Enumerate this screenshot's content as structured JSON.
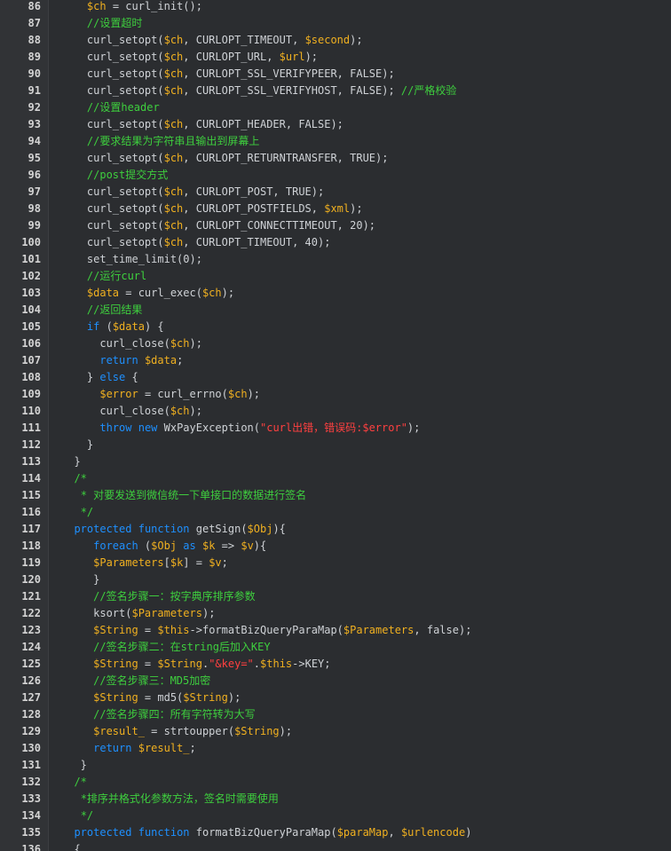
{
  "editor": {
    "lines": [
      {
        "n": "86",
        "t": [
          [
            "pl",
            "    "
          ],
          [
            "var",
            "$ch"
          ],
          [
            "pl",
            " = curl_init();"
          ]
        ]
      },
      {
        "n": "87",
        "t": [
          [
            "pl",
            "    "
          ],
          [
            "cm",
            "//设置超时"
          ]
        ]
      },
      {
        "n": "88",
        "t": [
          [
            "pl",
            "    curl_setopt("
          ],
          [
            "var",
            "$ch"
          ],
          [
            "pl",
            ", CURLOPT_TIMEOUT, "
          ],
          [
            "var",
            "$second"
          ],
          [
            "pl",
            ");"
          ]
        ]
      },
      {
        "n": "89",
        "t": [
          [
            "pl",
            "    curl_setopt("
          ],
          [
            "var",
            "$ch"
          ],
          [
            "pl",
            ", CURLOPT_URL, "
          ],
          [
            "var",
            "$url"
          ],
          [
            "pl",
            ");"
          ]
        ]
      },
      {
        "n": "90",
        "t": [
          [
            "pl",
            "    curl_setopt("
          ],
          [
            "var",
            "$ch"
          ],
          [
            "pl",
            ", CURLOPT_SSL_VERIFYPEER, FALSE);"
          ]
        ]
      },
      {
        "n": "91",
        "t": [
          [
            "pl",
            "    curl_setopt("
          ],
          [
            "var",
            "$ch"
          ],
          [
            "pl",
            ", CURLOPT_SSL_VERIFYHOST, FALSE); "
          ],
          [
            "cm",
            "//严格校验"
          ]
        ]
      },
      {
        "n": "92",
        "t": [
          [
            "pl",
            "    "
          ],
          [
            "cm",
            "//设置header"
          ]
        ]
      },
      {
        "n": "93",
        "t": [
          [
            "pl",
            "    curl_setopt("
          ],
          [
            "var",
            "$ch"
          ],
          [
            "pl",
            ", CURLOPT_HEADER, FALSE);"
          ]
        ]
      },
      {
        "n": "94",
        "t": [
          [
            "pl",
            "    "
          ],
          [
            "cm",
            "//要求结果为字符串且输出到屏幕上"
          ]
        ]
      },
      {
        "n": "95",
        "t": [
          [
            "pl",
            "    curl_setopt("
          ],
          [
            "var",
            "$ch"
          ],
          [
            "pl",
            ", CURLOPT_RETURNTRANSFER, TRUE);"
          ]
        ]
      },
      {
        "n": "96",
        "t": [
          [
            "pl",
            "    "
          ],
          [
            "cm",
            "//post提交方式"
          ]
        ]
      },
      {
        "n": "97",
        "t": [
          [
            "pl",
            "    curl_setopt("
          ],
          [
            "var",
            "$ch"
          ],
          [
            "pl",
            ", CURLOPT_POST, TRUE);"
          ]
        ]
      },
      {
        "n": "98",
        "t": [
          [
            "pl",
            "    curl_setopt("
          ],
          [
            "var",
            "$ch"
          ],
          [
            "pl",
            ", CURLOPT_POSTFIELDS, "
          ],
          [
            "var",
            "$xml"
          ],
          [
            "pl",
            ");"
          ]
        ]
      },
      {
        "n": "99",
        "t": [
          [
            "pl",
            "    curl_setopt("
          ],
          [
            "var",
            "$ch"
          ],
          [
            "pl",
            ", CURLOPT_CONNECTTIMEOUT, 20);"
          ]
        ]
      },
      {
        "n": "100",
        "t": [
          [
            "pl",
            "    curl_setopt("
          ],
          [
            "var",
            "$ch"
          ],
          [
            "pl",
            ", CURLOPT_TIMEOUT, 40);"
          ]
        ]
      },
      {
        "n": "101",
        "t": [
          [
            "pl",
            "    set_time_limit(0);"
          ]
        ]
      },
      {
        "n": "102",
        "t": [
          [
            "pl",
            "    "
          ],
          [
            "cm",
            "//运行curl"
          ]
        ]
      },
      {
        "n": "103",
        "t": [
          [
            "pl",
            "    "
          ],
          [
            "var",
            "$data"
          ],
          [
            "pl",
            " = curl_exec("
          ],
          [
            "var",
            "$ch"
          ],
          [
            "pl",
            ");"
          ]
        ]
      },
      {
        "n": "104",
        "t": [
          [
            "pl",
            "    "
          ],
          [
            "cm",
            "//返回结果"
          ]
        ]
      },
      {
        "n": "105",
        "t": [
          [
            "pl",
            "    "
          ],
          [
            "kw",
            "if"
          ],
          [
            "pl",
            " ("
          ],
          [
            "var",
            "$data"
          ],
          [
            "pl",
            ") {"
          ]
        ]
      },
      {
        "n": "106",
        "t": [
          [
            "pl",
            "      curl_close("
          ],
          [
            "var",
            "$ch"
          ],
          [
            "pl",
            ");"
          ]
        ]
      },
      {
        "n": "107",
        "t": [
          [
            "pl",
            "      "
          ],
          [
            "kw",
            "return"
          ],
          [
            "pl",
            " "
          ],
          [
            "var",
            "$data"
          ],
          [
            "pl",
            ";"
          ]
        ]
      },
      {
        "n": "108",
        "t": [
          [
            "pl",
            "    } "
          ],
          [
            "kw",
            "else"
          ],
          [
            "pl",
            " {"
          ]
        ]
      },
      {
        "n": "109",
        "t": [
          [
            "pl",
            "      "
          ],
          [
            "var",
            "$error"
          ],
          [
            "pl",
            " = curl_errno("
          ],
          [
            "var",
            "$ch"
          ],
          [
            "pl",
            ");"
          ]
        ]
      },
      {
        "n": "110",
        "t": [
          [
            "pl",
            "      curl_close("
          ],
          [
            "var",
            "$ch"
          ],
          [
            "pl",
            ");"
          ]
        ]
      },
      {
        "n": "111",
        "t": [
          [
            "pl",
            "      "
          ],
          [
            "kw",
            "throw"
          ],
          [
            "pl",
            " "
          ],
          [
            "kw",
            "new"
          ],
          [
            "pl",
            " WxPayException("
          ],
          [
            "str",
            "\"curl出错，错误码:$error\""
          ],
          [
            "pl",
            ");"
          ]
        ]
      },
      {
        "n": "112",
        "t": [
          [
            "pl",
            "    }"
          ]
        ]
      },
      {
        "n": "113",
        "t": [
          [
            "pl",
            "  }"
          ]
        ]
      },
      {
        "n": "114",
        "t": [
          [
            "pl",
            "  "
          ],
          [
            "cm",
            "/*"
          ]
        ]
      },
      {
        "n": "115",
        "t": [
          [
            "pl",
            "   "
          ],
          [
            "cm",
            "* 对要发送到微信统一下单接口的数据进行签名"
          ]
        ]
      },
      {
        "n": "116",
        "t": [
          [
            "pl",
            "   "
          ],
          [
            "cm",
            "*/"
          ]
        ]
      },
      {
        "n": "117",
        "t": [
          [
            "pl",
            "  "
          ],
          [
            "kw",
            "protected"
          ],
          [
            "pl",
            " "
          ],
          [
            "kw",
            "function"
          ],
          [
            "pl",
            " getSign("
          ],
          [
            "var",
            "$Obj"
          ],
          [
            "pl",
            "){"
          ]
        ]
      },
      {
        "n": "118",
        "t": [
          [
            "pl",
            "     "
          ],
          [
            "kw",
            "foreach"
          ],
          [
            "pl",
            " ("
          ],
          [
            "var",
            "$Obj"
          ],
          [
            "pl",
            " "
          ],
          [
            "kw",
            "as"
          ],
          [
            "pl",
            " "
          ],
          [
            "var",
            "$k"
          ],
          [
            "pl",
            " => "
          ],
          [
            "var",
            "$v"
          ],
          [
            "pl",
            "){"
          ]
        ]
      },
      {
        "n": "119",
        "t": [
          [
            "pl",
            "     "
          ],
          [
            "var",
            "$Parameters"
          ],
          [
            "pl",
            "["
          ],
          [
            "var",
            "$k"
          ],
          [
            "pl",
            "] = "
          ],
          [
            "var",
            "$v"
          ],
          [
            "pl",
            ";"
          ]
        ]
      },
      {
        "n": "120",
        "t": [
          [
            "pl",
            "     }"
          ]
        ]
      },
      {
        "n": "121",
        "t": [
          [
            "pl",
            "     "
          ],
          [
            "cm",
            "//签名步骤一：按字典序排序参数"
          ]
        ]
      },
      {
        "n": "122",
        "t": [
          [
            "pl",
            "     ksort("
          ],
          [
            "var",
            "$Parameters"
          ],
          [
            "pl",
            ");"
          ]
        ]
      },
      {
        "n": "123",
        "t": [
          [
            "pl",
            "     "
          ],
          [
            "var",
            "$String"
          ],
          [
            "pl",
            " = "
          ],
          [
            "var",
            "$this"
          ],
          [
            "pl",
            "->formatBizQueryParaMap("
          ],
          [
            "var",
            "$Parameters"
          ],
          [
            "pl",
            ", false);"
          ]
        ]
      },
      {
        "n": "124",
        "t": [
          [
            "pl",
            "     "
          ],
          [
            "cm",
            "//签名步骤二：在string后加入KEY"
          ]
        ]
      },
      {
        "n": "125",
        "t": [
          [
            "pl",
            "     "
          ],
          [
            "var",
            "$String"
          ],
          [
            "pl",
            " = "
          ],
          [
            "var",
            "$String"
          ],
          [
            "pl",
            "."
          ],
          [
            "str",
            "\"&key=\""
          ],
          [
            "pl",
            "."
          ],
          [
            "var",
            "$this"
          ],
          [
            "pl",
            "->KEY;"
          ]
        ]
      },
      {
        "n": "126",
        "t": [
          [
            "pl",
            "     "
          ],
          [
            "cm",
            "//签名步骤三：MD5加密"
          ]
        ]
      },
      {
        "n": "127",
        "t": [
          [
            "pl",
            "     "
          ],
          [
            "var",
            "$String"
          ],
          [
            "pl",
            " = md5("
          ],
          [
            "var",
            "$String"
          ],
          [
            "pl",
            ");"
          ]
        ]
      },
      {
        "n": "128",
        "t": [
          [
            "pl",
            "     "
          ],
          [
            "cm",
            "//签名步骤四：所有字符转为大写"
          ]
        ]
      },
      {
        "n": "129",
        "t": [
          [
            "pl",
            "     "
          ],
          [
            "var",
            "$result_"
          ],
          [
            "pl",
            " = strtoupper("
          ],
          [
            "var",
            "$String"
          ],
          [
            "pl",
            ");"
          ]
        ]
      },
      {
        "n": "130",
        "t": [
          [
            "pl",
            "     "
          ],
          [
            "kw",
            "return"
          ],
          [
            "pl",
            " "
          ],
          [
            "var",
            "$result_"
          ],
          [
            "pl",
            ";"
          ]
        ]
      },
      {
        "n": "131",
        "t": [
          [
            "pl",
            "   }"
          ]
        ]
      },
      {
        "n": "132",
        "t": [
          [
            "pl",
            "  "
          ],
          [
            "cm",
            "/*"
          ]
        ]
      },
      {
        "n": "133",
        "t": [
          [
            "pl",
            "   "
          ],
          [
            "cm",
            "*排序并格式化参数方法，签名时需要使用"
          ]
        ]
      },
      {
        "n": "134",
        "t": [
          [
            "pl",
            "   "
          ],
          [
            "cm",
            "*/"
          ]
        ]
      },
      {
        "n": "135",
        "t": [
          [
            "pl",
            "  "
          ],
          [
            "kw",
            "protected"
          ],
          [
            "pl",
            " "
          ],
          [
            "kw",
            "function"
          ],
          [
            "pl",
            " formatBizQueryParaMap("
          ],
          [
            "var",
            "$paraMap"
          ],
          [
            "pl",
            ", "
          ],
          [
            "var",
            "$urlencode"
          ],
          [
            "pl",
            ")"
          ]
        ]
      },
      {
        "n": "136",
        "t": [
          [
            "pl",
            "  {"
          ]
        ]
      }
    ]
  }
}
